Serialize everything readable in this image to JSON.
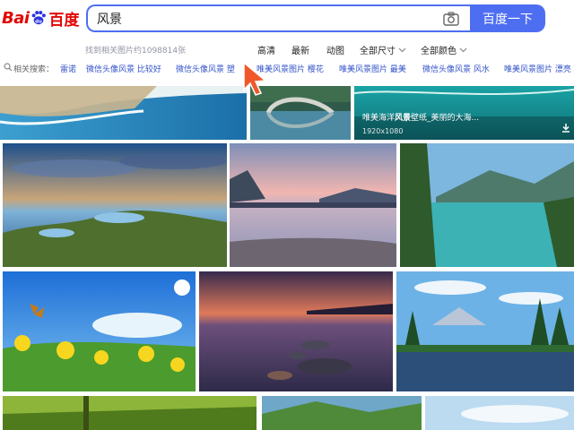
{
  "logo": {
    "part1": "Bai",
    "part2": "du",
    "cn": "百度"
  },
  "search": {
    "query": "风景",
    "button": "百度一下"
  },
  "filters": {
    "count": "找到相关图片约1098814张",
    "hd": "高清",
    "latest": "最新",
    "animated": "动图",
    "size": "全部尺寸",
    "color": "全部颜色"
  },
  "related": {
    "label": "相关搜索：",
    "items": [
      "雷诺",
      "微信头像风景 比较好",
      "微信头像风景 塑",
      "唯美风景图片 樱花",
      "唯美风景图片 最美",
      "微信头像风景 风水",
      "唯美风景图片 漂亮"
    ]
  },
  "featured": {
    "caption_pre": "唯美海洋",
    "caption_bold": "风景",
    "caption_post": "壁纸_美丽的大海...",
    "dimensions": "1920x1080"
  },
  "colors": {
    "accent": "#4e6ef2",
    "logo_red": "#e10602",
    "link": "#3152c8",
    "cursor": "#f0582a"
  }
}
